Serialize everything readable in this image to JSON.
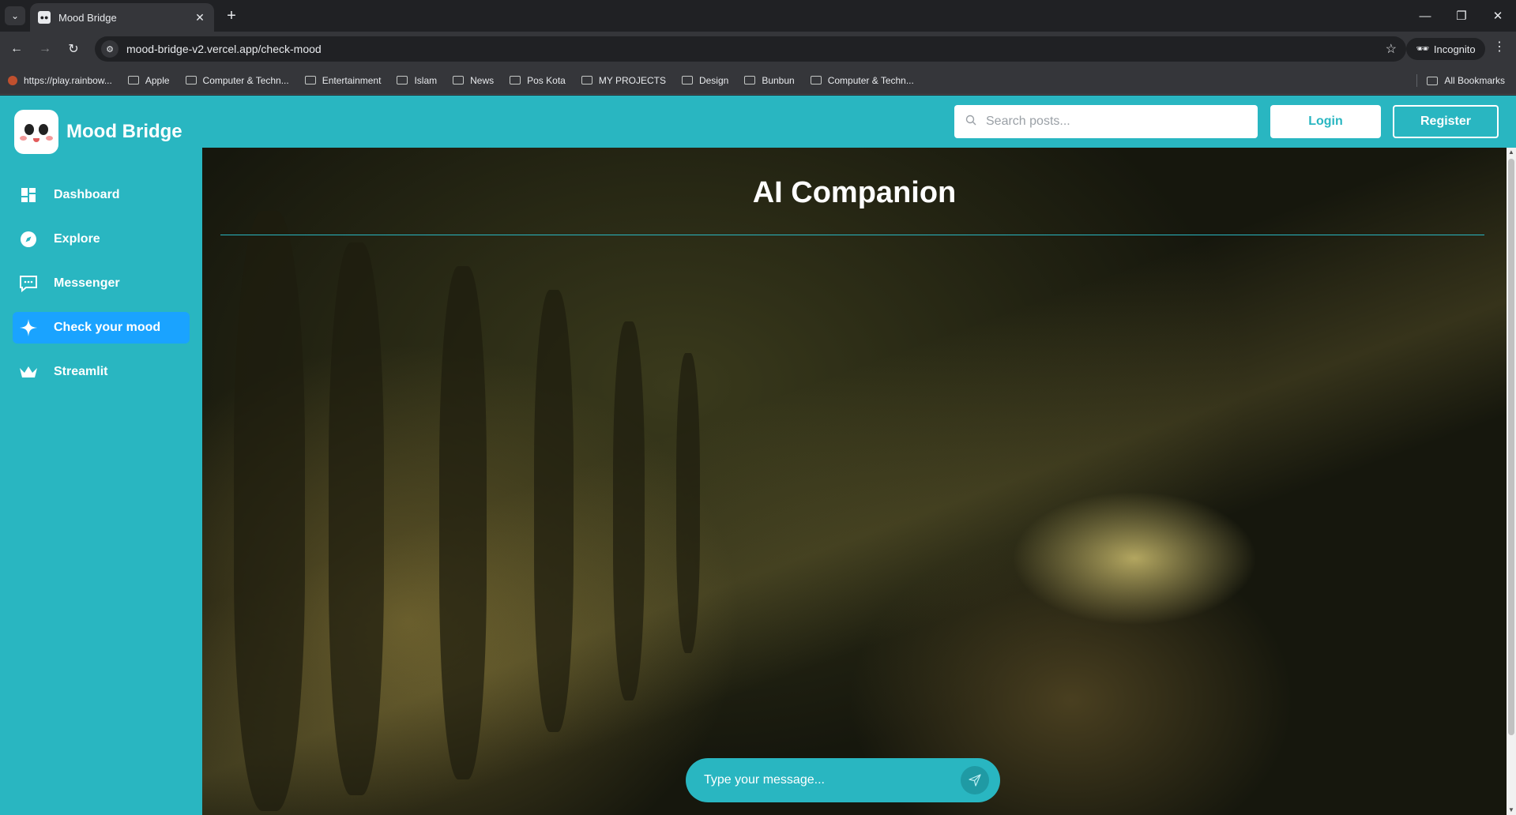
{
  "browser": {
    "tab_title": "Mood Bridge",
    "url": "mood-bridge-v2.vercel.app/check-mood",
    "incognito_label": "Incognito",
    "bookmarks": [
      {
        "label": "https://play.rainbow...",
        "icon": "site-favicon"
      },
      {
        "label": "Apple",
        "icon": "folder-icon"
      },
      {
        "label": "Computer & Techn...",
        "icon": "folder-icon"
      },
      {
        "label": "Entertainment",
        "icon": "folder-icon"
      },
      {
        "label": "Islam",
        "icon": "folder-icon"
      },
      {
        "label": "News",
        "icon": "folder-icon"
      },
      {
        "label": "Pos Kota",
        "icon": "folder-icon"
      },
      {
        "label": "MY PROJECTS",
        "icon": "folder-icon"
      },
      {
        "label": "Design",
        "icon": "folder-icon"
      },
      {
        "label": "Bunbun",
        "icon": "folder-icon"
      },
      {
        "label": "Computer & Techn...",
        "icon": "folder-icon"
      }
    ],
    "all_bookmarks_label": "All Bookmarks"
  },
  "brand": {
    "name": "Mood Bridge"
  },
  "sidebar": {
    "items": [
      {
        "label": "Dashboard",
        "icon": "dashboard-icon",
        "active": false
      },
      {
        "label": "Explore",
        "icon": "compass-icon",
        "active": false
      },
      {
        "label": "Messenger",
        "icon": "chat-icon",
        "active": false
      },
      {
        "label": "Check your mood",
        "icon": "sparkle-icon",
        "active": true
      },
      {
        "label": "Streamlit",
        "icon": "crown-icon",
        "active": false
      }
    ]
  },
  "header": {
    "search_placeholder": "Search posts...",
    "login_label": "Login",
    "register_label": "Register"
  },
  "main": {
    "title": "AI Companion",
    "message_placeholder": "Type your message..."
  },
  "colors": {
    "primary": "#29b6c1",
    "active_nav": "#1aa3ff",
    "white": "#ffffff"
  }
}
